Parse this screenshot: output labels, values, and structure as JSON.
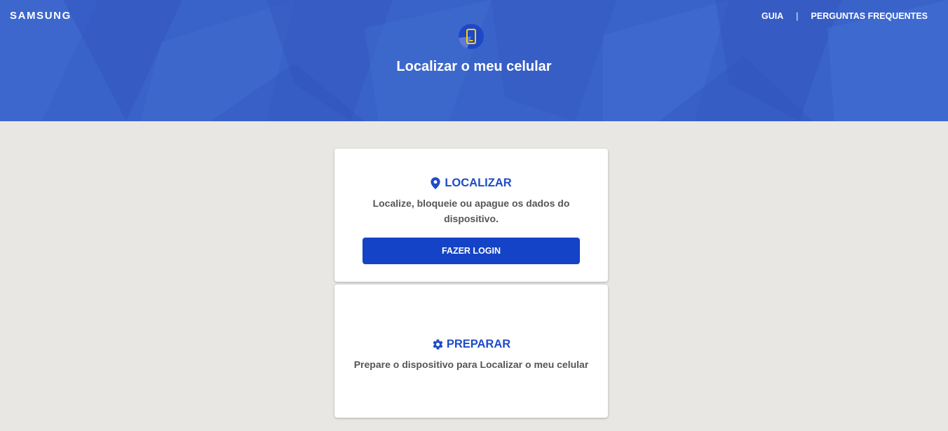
{
  "header": {
    "brand": "SAMSUNG",
    "nav": [
      {
        "label": "GUIA"
      },
      {
        "label": "PERGUNTAS FREQUENTES"
      }
    ],
    "separator": "|",
    "title": "Localizar o meu celular",
    "colors": {
      "background": "#3a63c9",
      "badge": "#1f48c4",
      "phone": "#ffd400"
    }
  },
  "cards": {
    "locate": {
      "icon": "location-pin-icon",
      "title": "LOCALIZAR",
      "description": "Localize, bloqueie ou apague os dados do dispositivo.",
      "button_label": "FAZER LOGIN"
    },
    "prepare": {
      "icon": "gear-icon",
      "title": "PREPARAR",
      "description": "Prepare o dispositivo para Localizar o meu celular"
    }
  },
  "colors": {
    "accent": "#1e4bc7",
    "button": "#1443c7",
    "page_bg": "#e8e7e3"
  }
}
